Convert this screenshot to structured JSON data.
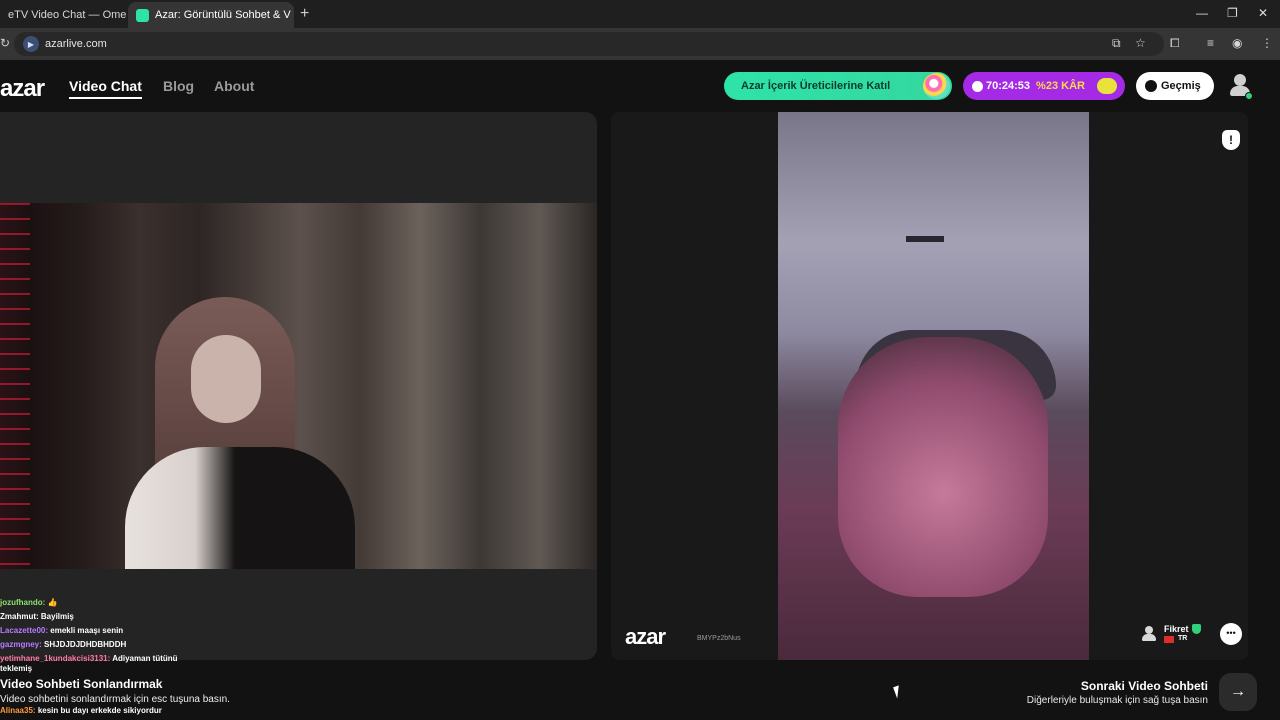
{
  "browser": {
    "tabs": [
      {
        "title": "eTV Video Chat — Ome",
        "recording": true
      },
      {
        "title": "Azar: Görüntülü Sohbet & V",
        "recording": true,
        "active": true
      }
    ],
    "url": "azarlive.com"
  },
  "header": {
    "logo": "azar",
    "nav": [
      "Video Chat",
      "Blog",
      "About"
    ],
    "creator_button": "Azar İçerik Üreticilerine Katıl",
    "timer": "70:24:53",
    "discount": "%23 KÂR",
    "history_button": "Geçmiş",
    "colors": {
      "creator": "#2ee3a8",
      "promo": "#a42ae6",
      "accent_yellow": "#ffd84a"
    }
  },
  "chat": {
    "messages": [
      {
        "user": "jozufhando:",
        "text": "👍",
        "color": "#8be36a"
      },
      {
        "user": "Zmahmut:",
        "text": "Bayilmiş",
        "color": "#ffffff"
      },
      {
        "user": "Lacazette00:",
        "text": "emekli maaşı senin",
        "color": "#b47cff"
      },
      {
        "user": "gazmgney:",
        "text": "SHJDJDJDHDBHDDH",
        "color": "#b47cff"
      },
      {
        "user": "yetimhane_1kundakcisi3131:",
        "text": "Adiyaman tütünü",
        "color": "#ff7aa8"
      },
      {
        "user": "",
        "text": "teklemiş",
        "color": "#ffffff"
      }
    ],
    "next_overlay": "Video Sohbeti Sonlandırmak",
    "esc_hint": "Video sohbetini sonlandırmak için esc tuşuna basın.",
    "last_message": {
      "user": "Alinaa35:",
      "text": "kesin bu dayı erkekde sikiyordur",
      "color": "#ff9a3c"
    }
  },
  "stream": {
    "watermark": "azar",
    "watermark_id": "BMYPz2bNus",
    "partner_name": "Fikret",
    "partner_country": "TR"
  },
  "footer": {
    "next_title": "Sonraki Video Sohbeti",
    "next_subtitle": "Diğerleriyle buluşmak için sağ tuşa basın",
    "next_arrow": "→"
  }
}
